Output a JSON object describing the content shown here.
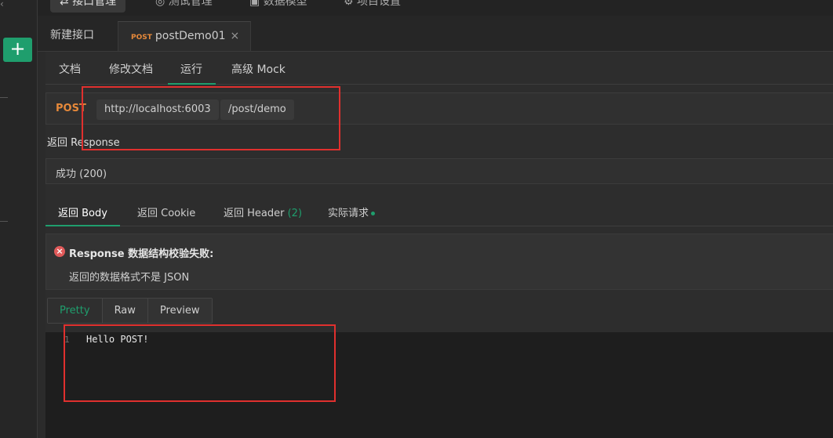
{
  "topnav": {
    "items": [
      {
        "label": "接口管理",
        "icon": "interface-icon"
      },
      {
        "label": "测试管理",
        "icon": "test-icon"
      },
      {
        "label": "数据模型",
        "icon": "model-icon"
      },
      {
        "label": "项目设置",
        "icon": "settings-icon"
      }
    ]
  },
  "sidebar": {
    "add_label": "+"
  },
  "doc_tabs": {
    "new": "新建接口",
    "active": {
      "method": "POST",
      "name": "postDemo01",
      "close": "×"
    }
  },
  "sub_tabs": [
    "文档",
    "修改文档",
    "运行",
    "高级 Mock"
  ],
  "request": {
    "method": "POST",
    "host": "http://localhost:6003",
    "path": "/post/demo"
  },
  "response": {
    "label": "返回 Response",
    "status": "成功 (200)"
  },
  "body_tabs": {
    "body": "返回 Body",
    "cookie": "返回 Cookie",
    "header": "返回 Header",
    "header_count": "(2)",
    "actual": "实际请求"
  },
  "validation": {
    "title": "Response 数据结构校验失败:",
    "message": "返回的数据格式不是 JSON"
  },
  "format_tabs": [
    "Pretty",
    "Raw",
    "Preview"
  ],
  "editor": {
    "line_number": "1",
    "code": "Hello POST!"
  },
  "colors": {
    "accent": "#1f9e6d",
    "post_method": "#e6893a",
    "error": "#e05a5a",
    "annotation": "#e0302e"
  }
}
